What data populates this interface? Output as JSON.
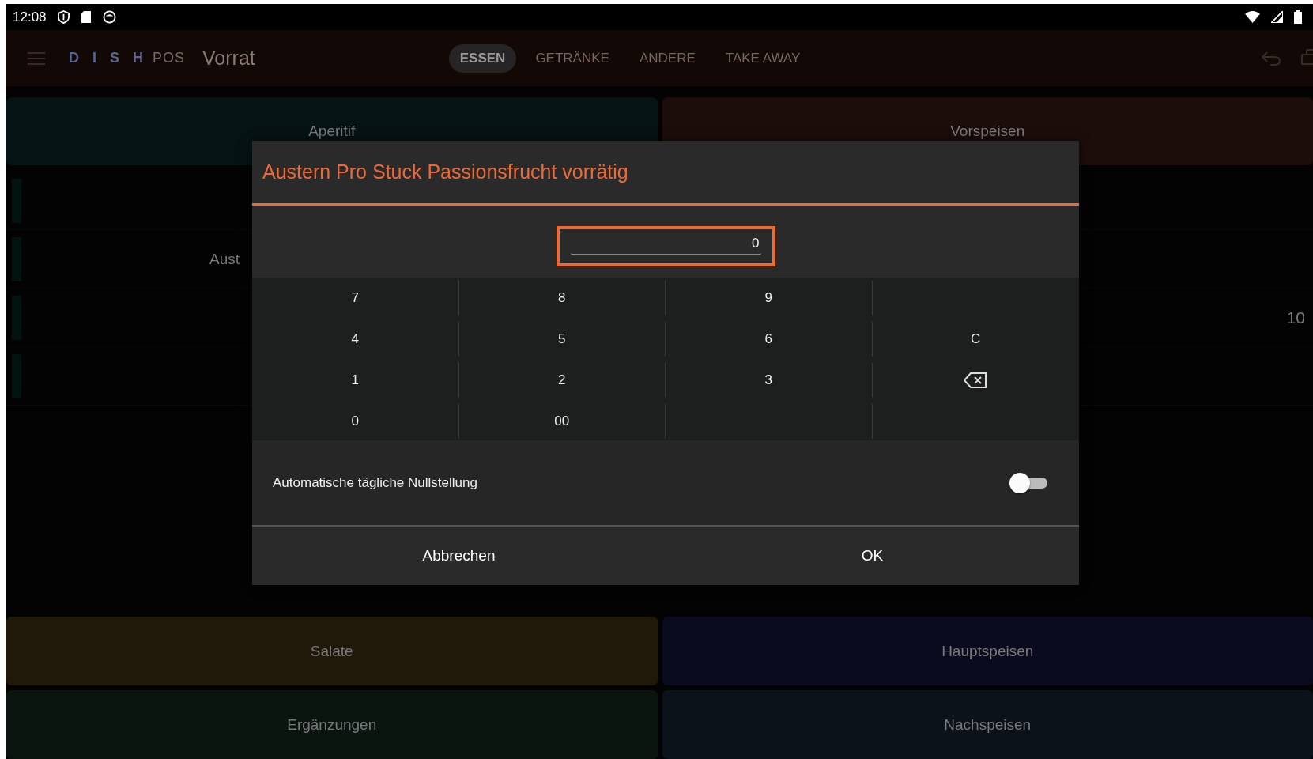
{
  "status_bar": {
    "time": "12:08"
  },
  "app_bar": {
    "logo": "D I S H",
    "logo_suffix": "POS",
    "title": "Vorrat",
    "tabs": [
      {
        "label": "ESSEN",
        "selected": true
      },
      {
        "label": "GETRÄNKE",
        "selected": false
      },
      {
        "label": "ANDERE",
        "selected": false
      },
      {
        "label": "TAKE AWAY",
        "selected": false
      }
    ]
  },
  "categories_top": [
    {
      "label": "Aperitif",
      "color": "#051312"
    },
    {
      "label": "Vorspeisen",
      "color": "#1c0d0a"
    }
  ],
  "stock_list": {
    "rows": [
      {},
      {
        "name": "Aust"
      },
      {
        "count": "10"
      },
      {}
    ]
  },
  "categories_bottom": [
    {
      "label": "Salate",
      "color": "#201808"
    },
    {
      "label": "Hauptspeisen",
      "color": "#0a0b1e"
    },
    {
      "label": "Ergänzungen",
      "color": "#0b150f"
    },
    {
      "label": "Nachspeisen",
      "color": "#0b121a"
    }
  ],
  "dialog": {
    "title": "Austern Pro Stuck Passionsfrucht vorrätig",
    "value": "0",
    "keys": [
      {
        "kind": "digit",
        "label": "7"
      },
      {
        "kind": "digit",
        "label": "8"
      },
      {
        "kind": "digit",
        "label": "9"
      },
      {
        "kind": "blank"
      },
      {
        "kind": "digit",
        "label": "4"
      },
      {
        "kind": "digit",
        "label": "5"
      },
      {
        "kind": "digit",
        "label": "6"
      },
      {
        "kind": "clear",
        "label": "C"
      },
      {
        "kind": "digit",
        "label": "1"
      },
      {
        "kind": "digit",
        "label": "2"
      },
      {
        "kind": "digit",
        "label": "3"
      },
      {
        "kind": "backspace"
      },
      {
        "kind": "digit",
        "label": "0"
      },
      {
        "kind": "digit",
        "label": "00"
      },
      {
        "kind": "blank"
      },
      {
        "kind": "blank"
      }
    ],
    "toggle": {
      "label": "Automatische tägliche Nullstellung",
      "on": false
    },
    "buttons": [
      {
        "label": "Abbrechen"
      },
      {
        "label": "OK"
      }
    ]
  }
}
